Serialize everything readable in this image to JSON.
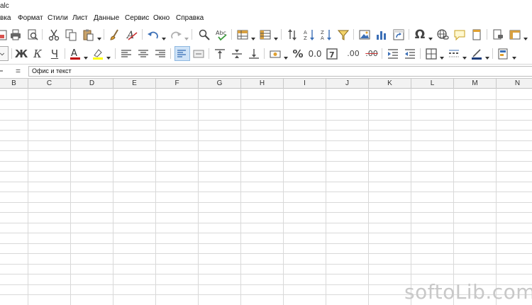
{
  "window": {
    "title": "alc"
  },
  "menu": [
    {
      "label": "вка"
    },
    {
      "label": "Формат"
    },
    {
      "label": "Стили"
    },
    {
      "label": "Лист"
    },
    {
      "label": "Данные"
    },
    {
      "label": "Сервис"
    },
    {
      "label": "Окно"
    },
    {
      "label": "Справка"
    }
  ],
  "toolbar2": {
    "bold": "Ж",
    "italic": "К",
    "underline": "Ч",
    "percent": "%",
    "decimal": "0.0",
    "decimal_add": ".00",
    "decimal_del": ".00",
    "font_color": "#c00000",
    "highlight_color": "#ffff00"
  },
  "formula_bar": {
    "equals": "=",
    "value": "Офис и текст"
  },
  "columns": [
    "B",
    "C",
    "D",
    "E",
    "F",
    "G",
    "H",
    "I",
    "J",
    "K",
    "L",
    "M",
    "N"
  ],
  "watermark": "softoLib.com"
}
